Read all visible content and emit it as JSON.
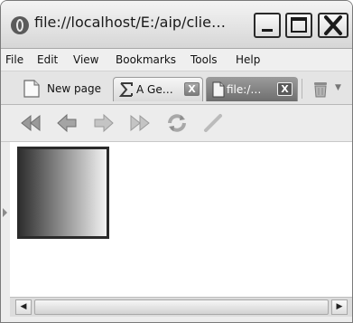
{
  "window": {
    "title": "file://localhost/E:/aip/clie…"
  },
  "menu": {
    "items": [
      "File",
      "Edit",
      "View",
      "Bookmarks",
      "Tools",
      "Help"
    ]
  },
  "tabs": {
    "new_page_label": "New page",
    "items": [
      {
        "label": "A Ge…",
        "icon": "sigma-icon",
        "active": false,
        "close": "X"
      },
      {
        "label": "file:/…",
        "icon": "document-icon",
        "active": true,
        "close": "X"
      }
    ]
  },
  "toolbar": {
    "buttons": [
      "rewind",
      "back",
      "forward",
      "fast-forward",
      "reload",
      "edit"
    ]
  },
  "scrollbar": {
    "left_arrow": "◀",
    "right_arrow": "▶"
  }
}
